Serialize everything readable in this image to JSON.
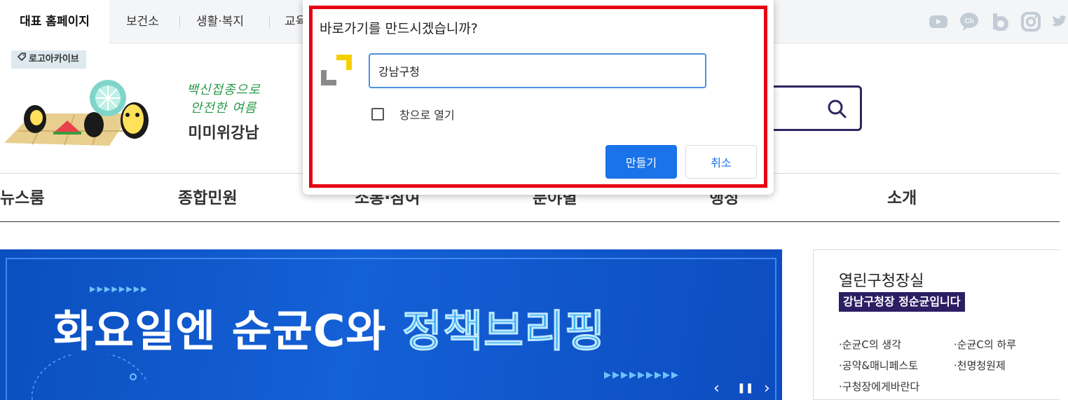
{
  "topbar": {
    "tabs": [
      "대표 홈페이지",
      "보건소",
      "생활·복지",
      "교육"
    ],
    "sns_icons": [
      "youtube-icon",
      "kakao-channel-icon",
      "blog-icon",
      "instagram-icon",
      "twitter-icon"
    ]
  },
  "header": {
    "archive_label": "로고아카이브",
    "campaign_script_line1": "백신접종으로",
    "campaign_script_line2": "안전한 여름",
    "campaign_brand": "미미위강남"
  },
  "gnb": {
    "items": [
      "뉴스룸",
      "종합민원",
      "소통·참여",
      "분야별",
      "행정",
      "소개"
    ]
  },
  "banner": {
    "headline_white": "화요일엔 순균C와 ",
    "headline_cyan": "정책브리핑",
    "prev": "‹",
    "pause": "❚❚",
    "next": "›"
  },
  "side": {
    "title": "열린구청장실",
    "tag": "강남구청장 정순균입니다",
    "links": [
      "·순균C의 생각",
      "·순균C의 하루",
      "·공약&매니페스토",
      "·천명청원제",
      "·구청장에게바란다"
    ]
  },
  "dialog": {
    "question": "바로가기를 만드시겠습니까?",
    "name_value": "강남구청",
    "checkbox_label": "창으로 열기",
    "create_label": "만들기",
    "cancel_label": "취소",
    "highlight_color": "#e60012",
    "accent_color": "#1a73e8"
  }
}
